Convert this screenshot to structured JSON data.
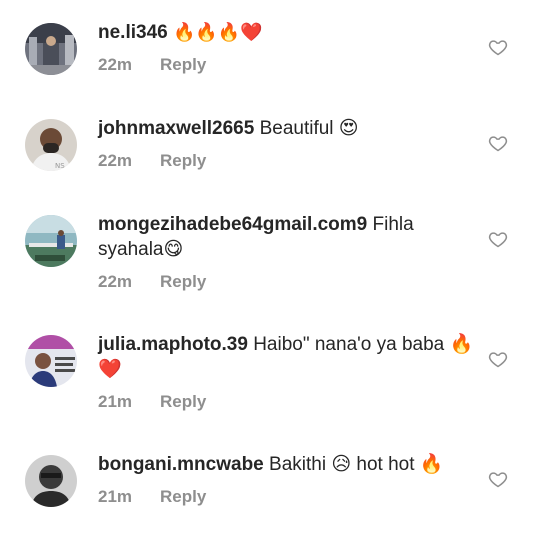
{
  "comments": [
    {
      "username": "ne.li346",
      "text": "🔥🔥🔥❤️",
      "time": "22m",
      "reply_label": "Reply",
      "avatar_icon": "profile-photo",
      "avatar_colors": [
        "#5b5f6e",
        "#9fa3ad"
      ]
    },
    {
      "username": "johnmaxwell2665",
      "text": "Beautiful 😍",
      "time": "22m",
      "reply_label": "Reply",
      "avatar_icon": "profile-photo",
      "avatar_colors": [
        "#c9c4bd",
        "#2b2623"
      ]
    },
    {
      "username": "mongezihadebe64gmail.com9",
      "text": "Fihla syahala😋",
      "time": "22m",
      "reply_label": "Reply",
      "avatar_icon": "profile-photo",
      "avatar_colors": [
        "#7ba9b5",
        "#3f6d54"
      ]
    },
    {
      "username": "julia.maphoto.39",
      "text": "Haibo\" nana'o ya baba 🔥❤️",
      "time": "21m",
      "reply_label": "Reply",
      "avatar_icon": "profile-photo",
      "avatar_colors": [
        "#d9dbe6",
        "#9b4fa0"
      ]
    },
    {
      "username": "bongani.mncwabe",
      "text": "Bakithi 😥 hot hot 🔥",
      "time": "21m",
      "reply_label": "Reply",
      "avatar_icon": "profile-photo",
      "avatar_colors": [
        "#c8c8c8",
        "#2a2a2a"
      ]
    }
  ],
  "like_icon": "heart-outline-icon",
  "colors": {
    "text": "#262626",
    "meta": "#8e8e8e",
    "heart_outline": "#8e8e8e"
  }
}
